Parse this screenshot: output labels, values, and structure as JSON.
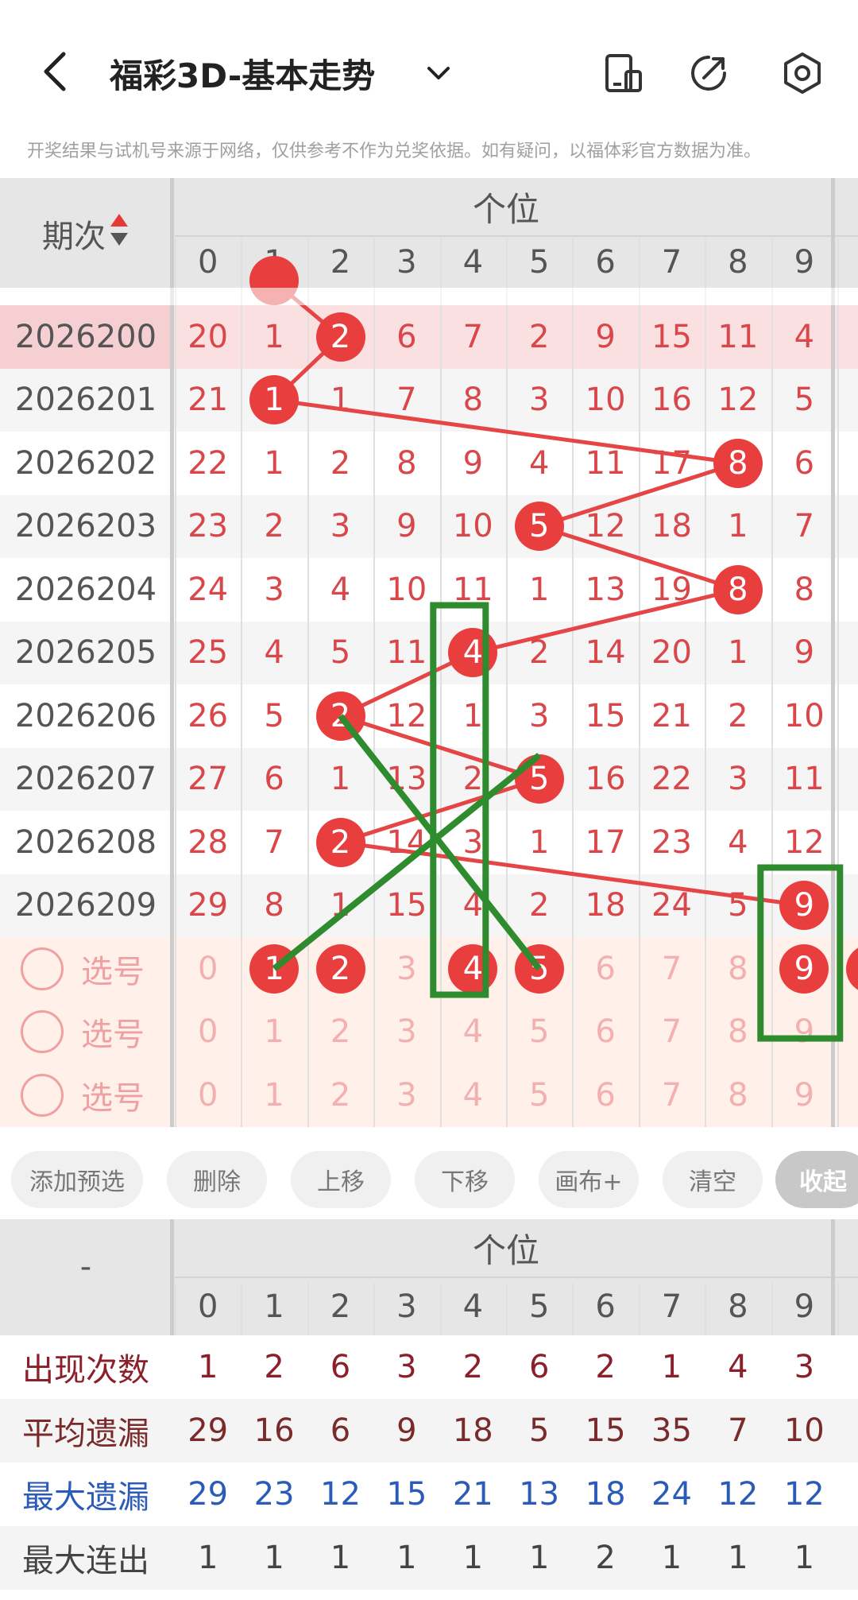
{
  "header": {
    "title": "福彩3D-基本走势",
    "back_icon": "chevron-left-icon",
    "dropdown_icon": "chevron-down-icon",
    "actions": [
      "phone-layout-icon",
      "share-icon",
      "settings-icon"
    ]
  },
  "disclaimer": "开奖结果与试机号来源于网络，仅供参考不作为兑奖依据。如有疑问，以福体彩官方数据为准。",
  "trend": {
    "group_title": "个位",
    "period_header": "期次",
    "digits": [
      "0",
      "1",
      "2",
      "3",
      "4",
      "5",
      "6",
      "7",
      "8",
      "9"
    ],
    "rows": [
      {
        "period": "2026200",
        "highlight": true,
        "hit": 2,
        "values": [
          "20",
          "1",
          "2",
          "6",
          "7",
          "2",
          "9",
          "15",
          "11",
          "4"
        ]
      },
      {
        "period": "2026201",
        "highlight": false,
        "hit": 1,
        "values": [
          "21",
          "1",
          "1",
          "7",
          "8",
          "3",
          "10",
          "16",
          "12",
          "5"
        ]
      },
      {
        "period": "2026202",
        "highlight": false,
        "hit": 8,
        "values": [
          "22",
          "1",
          "2",
          "8",
          "9",
          "4",
          "11",
          "17",
          "8",
          "6"
        ]
      },
      {
        "period": "2026203",
        "highlight": false,
        "hit": 5,
        "values": [
          "23",
          "2",
          "3",
          "9",
          "10",
          "5",
          "12",
          "18",
          "1",
          "7"
        ]
      },
      {
        "period": "2026204",
        "highlight": false,
        "hit": 8,
        "values": [
          "24",
          "3",
          "4",
          "10",
          "11",
          "1",
          "13",
          "19",
          "8",
          "8"
        ]
      },
      {
        "period": "2026205",
        "highlight": false,
        "hit": 4,
        "values": [
          "25",
          "4",
          "5",
          "11",
          "4",
          "2",
          "14",
          "20",
          "1",
          "9"
        ]
      },
      {
        "period": "2026206",
        "highlight": false,
        "hit": 2,
        "values": [
          "26",
          "5",
          "2",
          "12",
          "1",
          "3",
          "15",
          "21",
          "2",
          "10"
        ]
      },
      {
        "period": "2026207",
        "highlight": false,
        "hit": 5,
        "values": [
          "27",
          "6",
          "1",
          "13",
          "2",
          "5",
          "16",
          "22",
          "3",
          "11"
        ]
      },
      {
        "period": "2026208",
        "highlight": false,
        "hit": 2,
        "values": [
          "28",
          "7",
          "2",
          "14",
          "3",
          "1",
          "17",
          "23",
          "4",
          "12"
        ]
      },
      {
        "period": "2026209",
        "highlight": false,
        "hit": 9,
        "values": [
          "29",
          "8",
          "1",
          "15",
          "4",
          "2",
          "18",
          "24",
          "5",
          "9"
        ]
      }
    ],
    "select_rows": [
      {
        "label": "选号",
        "selected": [
          1,
          2,
          4,
          5,
          9
        ]
      },
      {
        "label": "选号",
        "selected": []
      },
      {
        "label": "选号",
        "selected": []
      }
    ]
  },
  "toolbar": {
    "buttons": [
      "添加预选",
      "删除",
      "上移",
      "下移",
      "画布+",
      "清空",
      "收起"
    ]
  },
  "stats": {
    "group_title": "个位",
    "corner": "-",
    "digits": [
      "0",
      "1",
      "2",
      "3",
      "4",
      "5",
      "6",
      "7",
      "8",
      "9"
    ],
    "rows": [
      {
        "label": "出现次数",
        "color": "#8b1f2a",
        "values": [
          "1",
          "2",
          "6",
          "3",
          "2",
          "6",
          "2",
          "1",
          "4",
          "3"
        ]
      },
      {
        "label": "平均遗漏",
        "color": "#7a2a2a",
        "values": [
          "29",
          "16",
          "6",
          "9",
          "18",
          "5",
          "15",
          "35",
          "7",
          "10"
        ]
      },
      {
        "label": "最大遗漏",
        "color": "#2b5bb8",
        "values": [
          "29",
          "23",
          "12",
          "15",
          "21",
          "13",
          "18",
          "24",
          "12",
          "12"
        ]
      },
      {
        "label": "最大连出",
        "color": "#444444",
        "values": [
          "1",
          "1",
          "1",
          "1",
          "1",
          "1",
          "2",
          "1",
          "1",
          "1"
        ]
      }
    ]
  },
  "colors": {
    "ball": "#e83e3e",
    "miss_number": "#d9474a",
    "highlight_row": "#fbe0e2",
    "select_area": "#fff0ea",
    "annotation": "#2e8b2e"
  }
}
